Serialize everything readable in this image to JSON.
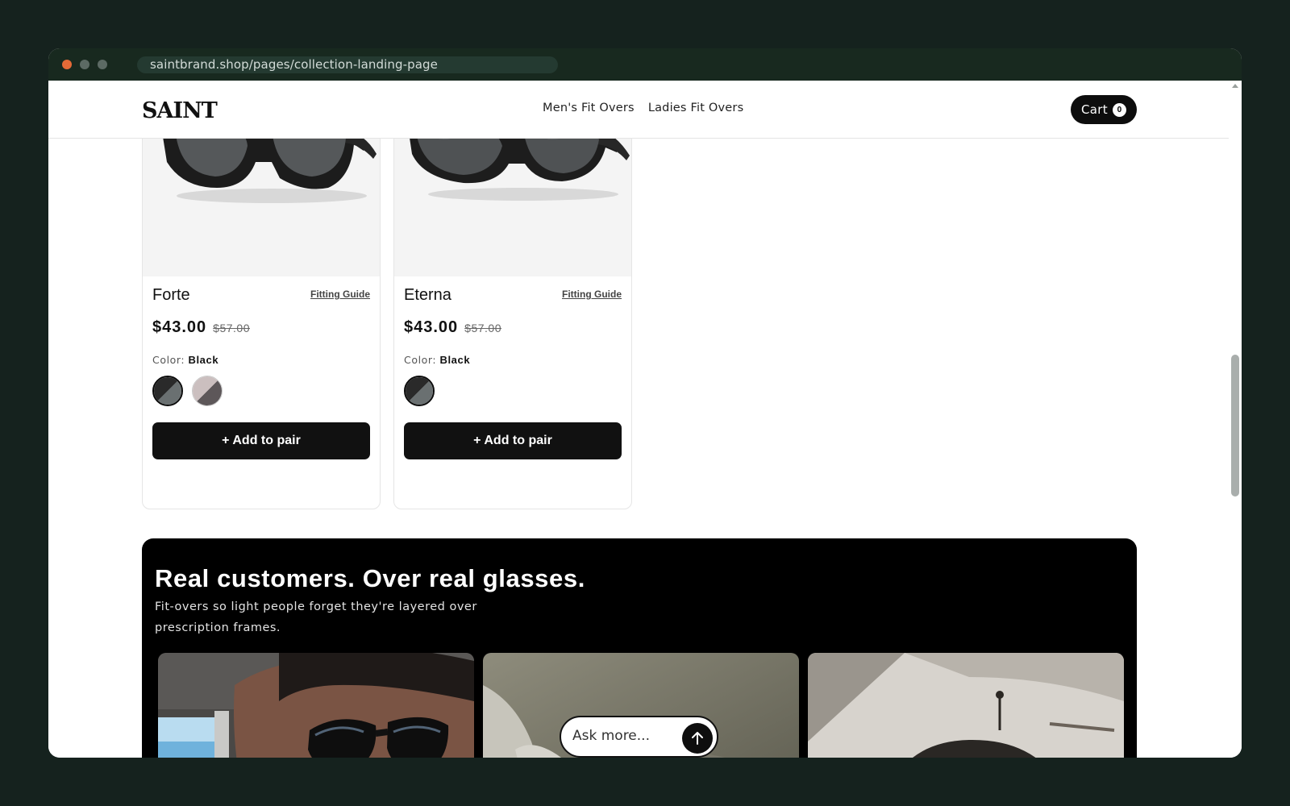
{
  "browser": {
    "url": "saintbrand.shop/pages/collection-landing-page"
  },
  "header": {
    "logo": "SAINT",
    "nav": [
      {
        "label": "Men's Fit Overs"
      },
      {
        "label": "Ladies Fit Overs"
      }
    ],
    "cart": {
      "label": "Cart",
      "count": "0"
    }
  },
  "products": [
    {
      "name": "Forte",
      "fitting_guide": "Fitting Guide",
      "price": "$43.00",
      "compare_price": "$57.00",
      "color_label": "Color:",
      "color_value": "Black",
      "add_label": "+ Add to pair"
    },
    {
      "name": "Eterna",
      "fitting_guide": "Fitting Guide",
      "price": "$43.00",
      "compare_price": "$57.00",
      "color_label": "Color:",
      "color_value": "Black",
      "add_label": "+ Add to pair"
    }
  ],
  "testimonials": {
    "title": "Real customers. Over real glasses.",
    "subtitle": "Fit-overs so light people forget they're layered over prescription frames."
  },
  "chat": {
    "placeholder": "Ask more..."
  },
  "colors": {
    "accent": "#0d0d0d",
    "window_chrome": "#18291f",
    "close_dot": "#e56a37"
  }
}
